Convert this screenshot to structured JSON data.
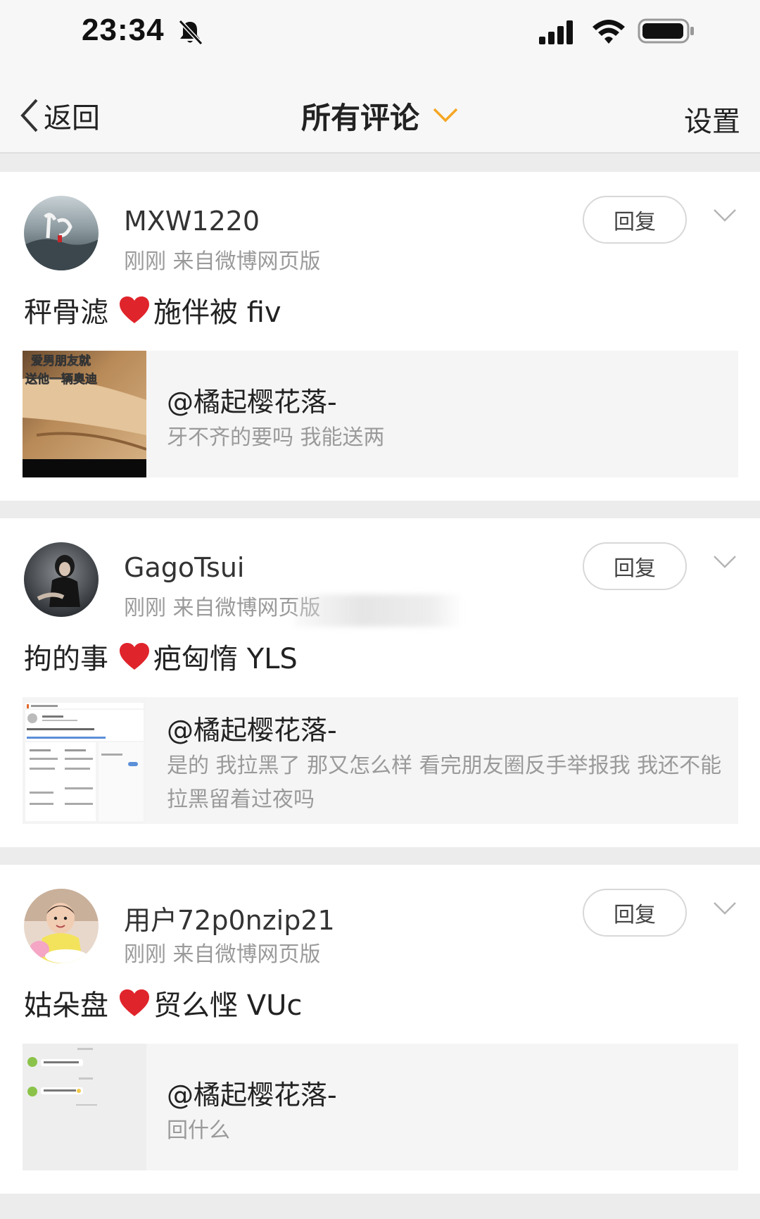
{
  "status_bar": {
    "time": "23:34"
  },
  "nav": {
    "back_label": "返回",
    "title": "所有评论",
    "settings_label": "设置",
    "accent_color": "#f5a623"
  },
  "comments": [
    {
      "username": "MXW1220",
      "meta": "刚刚  来自微博网页版",
      "reply_label": "回复",
      "text_before": "秤骨滤",
      "text_after": "施伴被 fiv",
      "quote": {
        "author": "@橘起樱花落-",
        "text": "牙不齐的要吗 我能送两",
        "thumb_text": [
          "爱男朋友就",
          "送他一辆奥迪"
        ]
      }
    },
    {
      "username": "GagoTsui",
      "meta": "刚刚  来自微博网页版",
      "reply_label": "回复",
      "text_before": "拘的事",
      "text_after": "疤匈惰 YLS",
      "quote": {
        "author": "@橘起樱花落-",
        "text": "是的 我拉黑了 那又怎么样 看完朋友圈反手举报我 我还不能拉黑留着过夜吗"
      }
    },
    {
      "username": "用户72p0nzip21",
      "meta": "刚刚  来自微博网页版",
      "reply_label": "回复",
      "text_before": "姑朵盘",
      "text_after": "贸么悭 VUc",
      "quote": {
        "author": "@橘起樱花落-",
        "text": "回什么"
      }
    }
  ]
}
